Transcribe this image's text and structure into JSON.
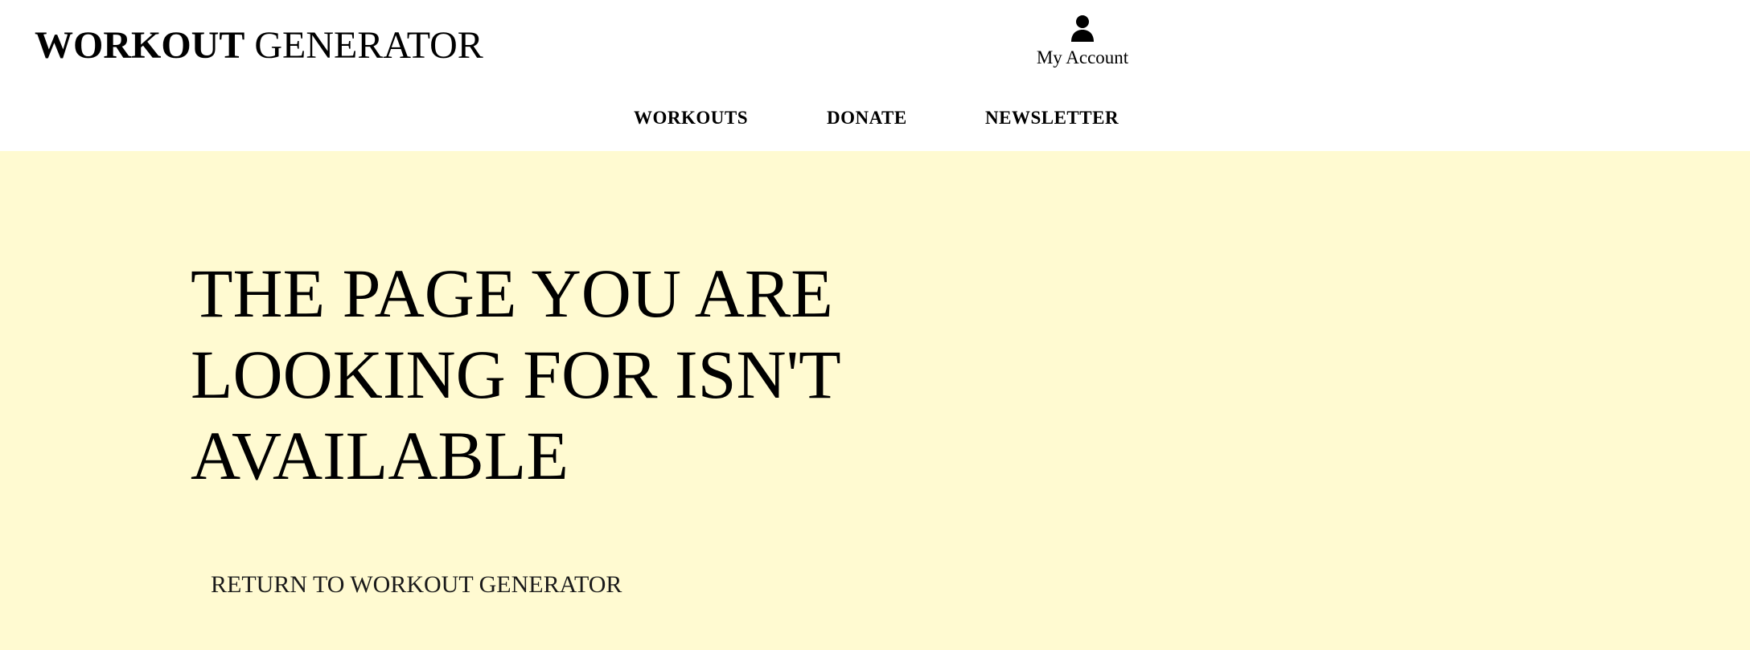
{
  "header": {
    "logo_bold": "WORKOUT",
    "logo_normal": "GENERATOR",
    "account": {
      "icon": "user-icon",
      "label": "My Account"
    },
    "nav": {
      "workouts": "WORKOUTS",
      "donate": "DONATE",
      "newsletter": "NEWSLETTER"
    }
  },
  "main": {
    "headline": "THE PAGE YOU ARE LOOKING FOR ISN'T AVAILABLE",
    "return_link": "RETURN TO WORKOUT GENERATOR",
    "background_color": "#fffad1"
  }
}
